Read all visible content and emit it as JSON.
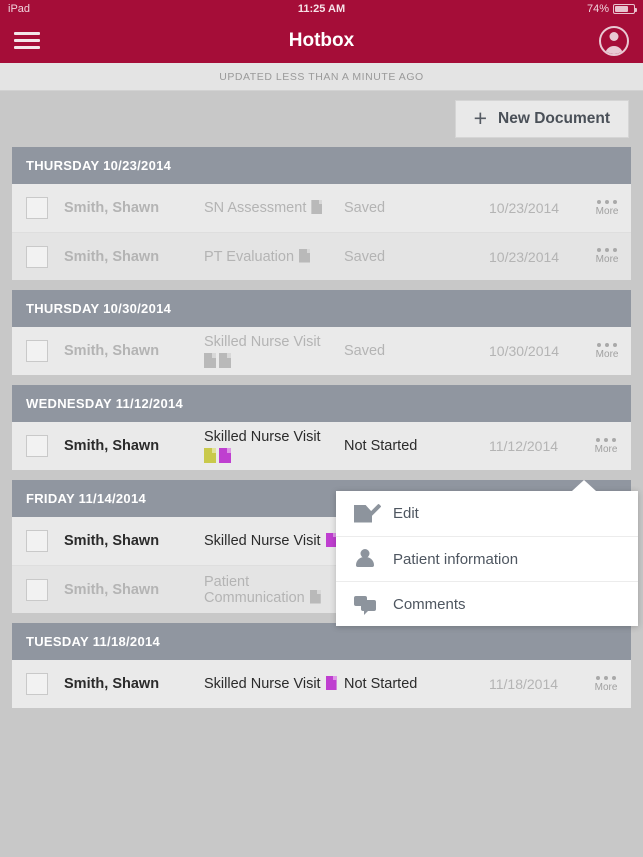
{
  "statusbar": {
    "device": "iPad",
    "time": "11:25 AM",
    "battery": "74%"
  },
  "navbar": {
    "title": "Hotbox",
    "menu_icon": "hamburger-menu-icon",
    "avatar_icon": "user-avatar-icon"
  },
  "updated": {
    "text": "UPDATED LESS THAN A MINUTE AGO"
  },
  "toolbar": {
    "new_document_label": "New Document",
    "plus_icon": "plus-icon"
  },
  "colors": {
    "brand": "#a50d38",
    "section_header": "#9096a0",
    "doc_yellow": "#c9c94b",
    "doc_purple": "#bf3fd0",
    "doc_gray": "#b9b9b9"
  },
  "more_label": "More",
  "sections": [
    {
      "title": "THURSDAY 10/23/2014",
      "rows": [
        {
          "name": "Smith, Shawn",
          "type": "SN Assessment",
          "docs": [
            "gray"
          ],
          "status": "Saved",
          "date": "10/23/2014",
          "active": false
        },
        {
          "name": "Smith, Shawn",
          "type": "PT Evaluation",
          "docs": [
            "gray"
          ],
          "status": "Saved",
          "date": "10/23/2014",
          "active": false
        }
      ]
    },
    {
      "title": "THURSDAY 10/30/2014",
      "rows": [
        {
          "name": "Smith, Shawn",
          "type": "Skilled Nurse Visit",
          "docs": [
            "gray",
            "gray"
          ],
          "docs_below": true,
          "status": "Saved",
          "date": "10/30/2014",
          "active": false
        }
      ]
    },
    {
      "title": "WEDNESDAY 11/12/2014",
      "rows": [
        {
          "name": "Smith, Shawn",
          "type": "Skilled Nurse Visit",
          "docs": [
            "yellow",
            "purple"
          ],
          "docs_below": true,
          "status": "Not Started",
          "date": "11/12/2014",
          "active": true
        }
      ]
    },
    {
      "title": "FRIDAY 11/14/2014",
      "rows": [
        {
          "name": "Smith, Shawn",
          "type": "Skilled Nurse Visit",
          "docs": [
            "purple"
          ],
          "status": "",
          "date": "",
          "active": true
        },
        {
          "name": "Smith, Shawn",
          "type": "Patient Communication",
          "docs": [
            "gray"
          ],
          "status": "",
          "date": "",
          "active": false
        }
      ]
    },
    {
      "title": "TUESDAY 11/18/2014",
      "rows": [
        {
          "name": "Smith, Shawn",
          "type": "Skilled Nurse Visit",
          "docs": [
            "purple"
          ],
          "status": "Not Started",
          "date": "11/18/2014",
          "active": true
        }
      ]
    }
  ],
  "popover": {
    "items": [
      {
        "label": "Edit",
        "icon": "edit-pencil-icon"
      },
      {
        "label": "Patient information",
        "icon": "person-icon"
      },
      {
        "label": "Comments",
        "icon": "comments-icon"
      }
    ]
  }
}
